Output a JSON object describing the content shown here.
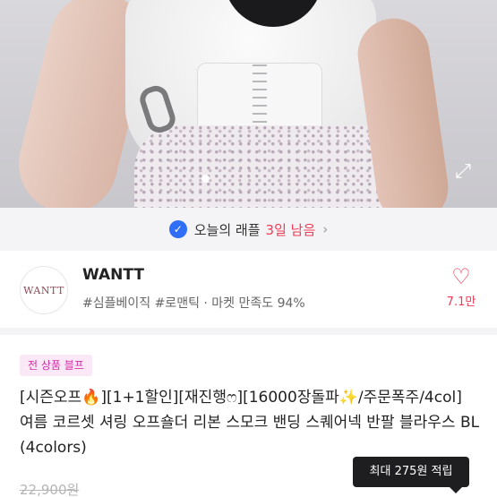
{
  "product_image": {
    "description_icon": "expand-icon"
  },
  "raffle": {
    "label": "오늘의 래플",
    "highlight": "3일 남음",
    "check_icon": "✓",
    "chevron": "›"
  },
  "seller": {
    "logo_text": "WANTT",
    "name": "WANTT",
    "tags": "#심플베이직 #로맨틱 · 마켓 만족도 94%",
    "heart_icon": "♡",
    "likes": "7.1만"
  },
  "product": {
    "sale_badge": "전 상품 블프",
    "title": "[시즌오프🔥][1+1할인][재진행ෆ][16000장돌파✨/주문폭주/4col]여름 코르셋 셔링 오프숄더 리본 스모크 밴딩 스퀘어넥 반팔 블라우스 BL (4colors)",
    "original_price": "22,900원",
    "reward_tip": "최대 275원 적립"
  },
  "colors": {
    "accent_pink": "#f03a55",
    "badge_text": "#d12fa6",
    "badge_bg": "#fbe8f6",
    "verify_blue": "#2f6ef6"
  }
}
